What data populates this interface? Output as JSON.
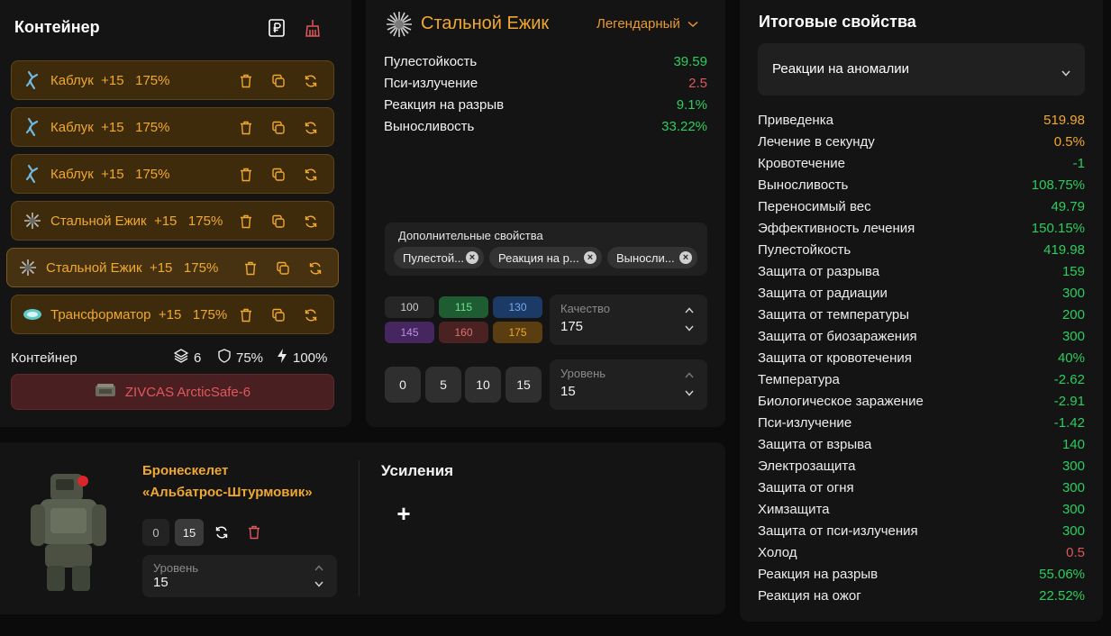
{
  "container": {
    "title": "Контейнер",
    "slots": [
      {
        "name": "Каблук",
        "plus": "+15",
        "pct": "175%",
        "icon": "kabluk-icon"
      },
      {
        "name": "Каблук",
        "plus": "+15",
        "pct": "175%",
        "icon": "kabluk-icon"
      },
      {
        "name": "Каблук",
        "plus": "+15",
        "pct": "175%",
        "icon": "kabluk-icon"
      },
      {
        "name": "Стальной Ежик",
        "plus": "+15",
        "pct": "175%",
        "icon": "steel-hedgehog-icon"
      },
      {
        "name": "Стальной Ежик",
        "plus": "+15",
        "pct": "175%",
        "icon": "steel-hedgehog-icon"
      },
      {
        "name": "Трансформатор",
        "plus": "+15",
        "pct": "175%",
        "icon": "transformer-icon"
      }
    ],
    "stats_label": "Контейнер",
    "capacity": "6",
    "protection": "75%",
    "efficiency": "100%",
    "item_name": "ZIVCAS ArcticSafe-6"
  },
  "artifact": {
    "name": "Стальной Ежик",
    "rarity": "Легендарный",
    "props": [
      {
        "k": "Пулестойкость",
        "v": "39.59",
        "color": "green"
      },
      {
        "k": "Пси-излучение",
        "v": "2.5",
        "color": "red"
      },
      {
        "k": "Реакция на разрыв",
        "v": "9.1%",
        "color": "green"
      },
      {
        "k": "Выносливость",
        "v": "33.22%",
        "color": "green"
      }
    ],
    "extra_title": "Дополнительные свойства",
    "extra_chips": [
      "Пулестой...",
      "Реакция на р...",
      "Выносли..."
    ],
    "quality_buttons": [
      "100",
      "115",
      "130",
      "145",
      "160",
      "175"
    ],
    "quality_label": "Качество",
    "quality_value": "175",
    "level_buttons": [
      "0",
      "5",
      "10",
      "15"
    ],
    "level_label": "Уровень",
    "level_value": "15"
  },
  "armor": {
    "name_line1": "Бронескелет",
    "name_line2": "«Альбатрос-Штурмовик»",
    "btn_min": "0",
    "btn_max": "15",
    "level_label": "Уровень",
    "level_value": "15",
    "boosts_title": "Усиления",
    "add": "+"
  },
  "results": {
    "title": "Итоговые свойства",
    "filter": "Реакции на аномалии",
    "rows": [
      {
        "k": "Приведенка",
        "v": "519.98",
        "color": "orange"
      },
      {
        "k": "Лечение в секунду",
        "v": "0.5%",
        "color": "orange"
      },
      {
        "k": "Кровотечение",
        "v": "-1",
        "color": "green"
      },
      {
        "k": "Выносливость",
        "v": "108.75%",
        "color": "green"
      },
      {
        "k": "Переносимый вес",
        "v": "49.79",
        "color": "green"
      },
      {
        "k": "Эффективность лечения",
        "v": "150.15%",
        "color": "green"
      },
      {
        "k": "Пулестойкость",
        "v": "419.98",
        "color": "green"
      },
      {
        "k": "Защита от разрыва",
        "v": "159",
        "color": "green"
      },
      {
        "k": "Защита от радиации",
        "v": "300",
        "color": "green"
      },
      {
        "k": "Защита от температуры",
        "v": "200",
        "color": "green"
      },
      {
        "k": "Защита от биозаражения",
        "v": "300",
        "color": "green"
      },
      {
        "k": "Защита от кровотечения",
        "v": "40%",
        "color": "green"
      },
      {
        "k": "Температура",
        "v": "-2.62",
        "color": "green"
      },
      {
        "k": "Биологическое заражение",
        "v": "-2.91",
        "color": "green"
      },
      {
        "k": "Пси-излучение",
        "v": "-1.42",
        "color": "green"
      },
      {
        "k": "Защита от взрыва",
        "v": "140",
        "color": "green"
      },
      {
        "k": "Электрозащита",
        "v": "300",
        "color": "green"
      },
      {
        "k": "Защита от огня",
        "v": "300",
        "color": "green"
      },
      {
        "k": "Химзащита",
        "v": "300",
        "color": "green"
      },
      {
        "k": "Защита от пси-излучения",
        "v": "300",
        "color": "green"
      },
      {
        "k": "Холод",
        "v": "0.5",
        "color": "red"
      },
      {
        "k": "Реакция на разрыв",
        "v": "55.06%",
        "color": "green"
      },
      {
        "k": "Реакция на ожог",
        "v": "22.52%",
        "color": "green"
      }
    ]
  },
  "colors": {
    "accent": "#f0a830",
    "positive": "#2ecc5f",
    "negative": "#e0585c",
    "panel": "#141414"
  }
}
